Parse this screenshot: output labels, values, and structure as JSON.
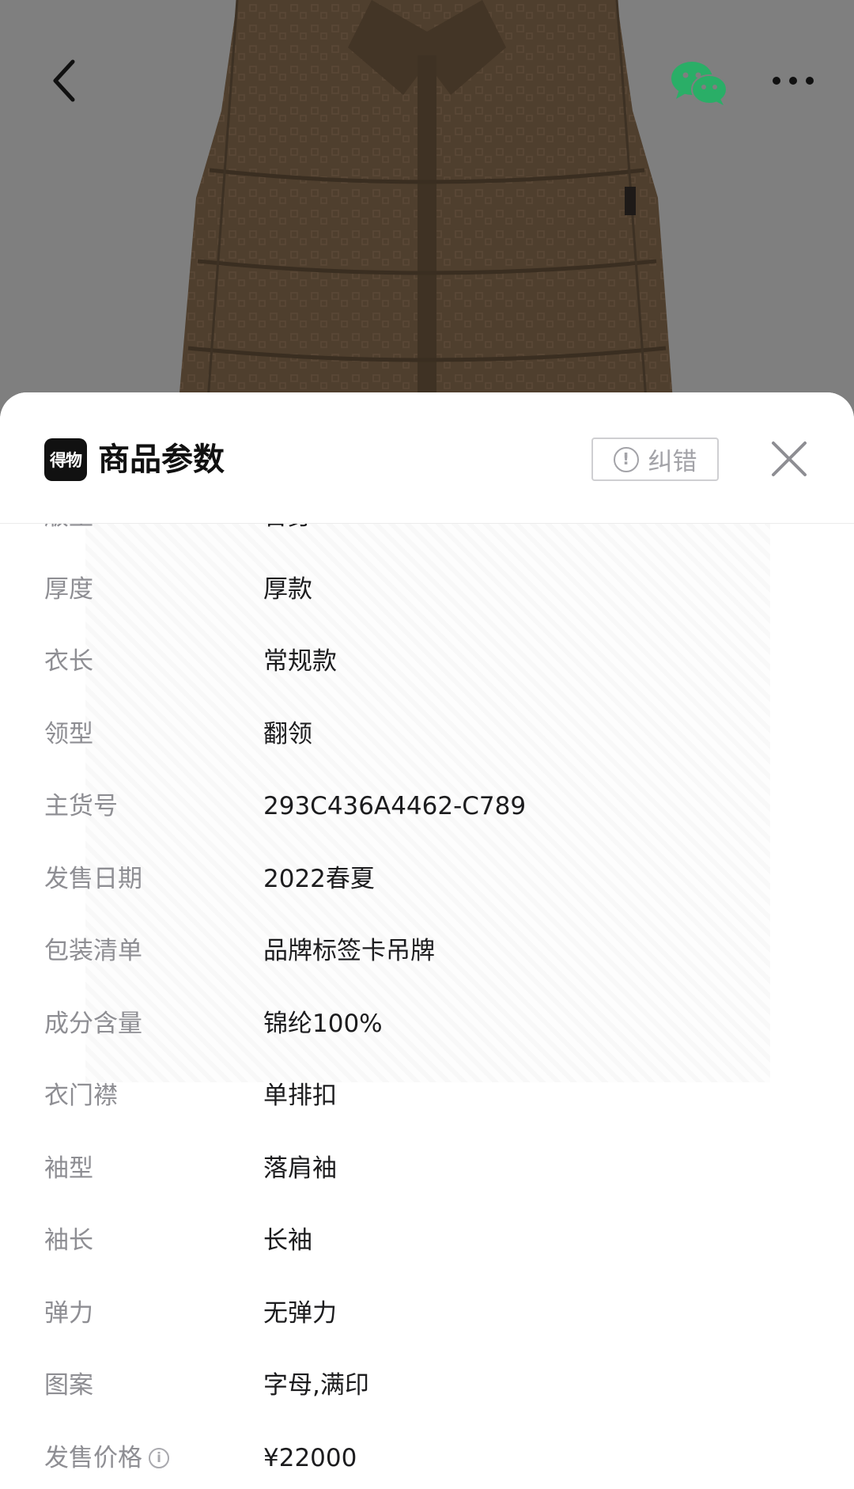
{
  "topbar": {
    "back_icon": "chevron-left-icon",
    "share_icon": "wechat-icon",
    "more_icon": "more-dots-icon",
    "wechat_color": "#2aae67"
  },
  "sheet": {
    "brand_logo_text": "得物",
    "title": "商品参数",
    "report_icon": "exclamation-circle-icon",
    "report_label": "纠错",
    "close_icon": "close-icon"
  },
  "params": [
    {
      "label": "版型",
      "value": "合身"
    },
    {
      "label": "厚度",
      "value": "厚款"
    },
    {
      "label": "衣长",
      "value": "常规款"
    },
    {
      "label": "领型",
      "value": "翻领"
    },
    {
      "label": "主货号",
      "value": "293C436A4462-C789"
    },
    {
      "label": "发售日期",
      "value": "2022春夏"
    },
    {
      "label": "包装清单",
      "value": "品牌标签卡吊牌"
    },
    {
      "label": "成分含量",
      "value": "锦纶100%"
    },
    {
      "label": "衣门襟",
      "value": "单排扣"
    },
    {
      "label": "袖型",
      "value": "落肩袖"
    },
    {
      "label": "袖长",
      "value": "长袖"
    },
    {
      "label": "弹力",
      "value": "无弹力"
    },
    {
      "label": "图案",
      "value": "字母,满印"
    },
    {
      "label": "发售价格",
      "value": "¥22000",
      "has_info": true
    }
  ],
  "colors": {
    "label": "#8e8e93",
    "value": "#1c1c1e",
    "backdrop": "#7f7f7f",
    "jacket": "#4f3f2e"
  }
}
